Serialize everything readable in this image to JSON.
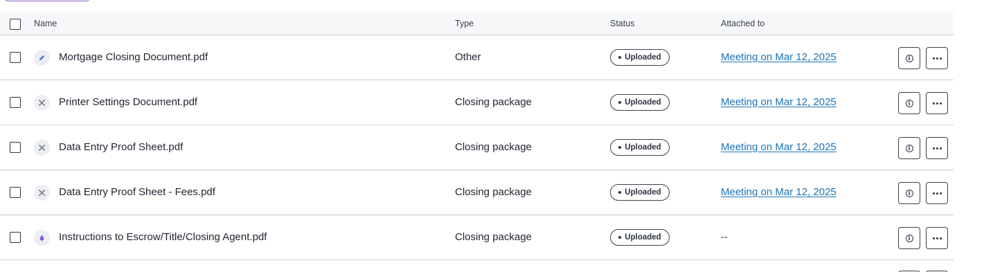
{
  "columns": {
    "name": "Name",
    "type": "Type",
    "status": "Status",
    "attached": "Attached to"
  },
  "rows": [
    {
      "name": "Mortgage Closing Document.pdf",
      "icon": "pencil-icon",
      "type": "Other",
      "status": "Uploaded",
      "attached": "Meeting on Mar 12, 2025",
      "attached_is_link": true
    },
    {
      "name": "Printer Settings Document.pdf",
      "icon": "tools-icon",
      "type": "Closing package",
      "status": "Uploaded",
      "attached": "Meeting on Mar 12, 2025",
      "attached_is_link": true
    },
    {
      "name": "Data Entry Proof Sheet.pdf",
      "icon": "tools-icon",
      "type": "Closing package",
      "status": "Uploaded",
      "attached": "Meeting on Mar 12, 2025",
      "attached_is_link": true
    },
    {
      "name": "Data Entry Proof Sheet - Fees.pdf",
      "icon": "tools-icon",
      "type": "Closing package",
      "status": "Uploaded",
      "attached": "Meeting on Mar 12, 2025",
      "attached_is_link": true
    },
    {
      "name": "Instructions to Escrow/Title/Closing Agent.pdf",
      "icon": "drop-icon",
      "type": "Closing package",
      "status": "Uploaded",
      "attached": "--",
      "attached_is_link": false
    }
  ],
  "colors": {
    "link": "#1a73b8",
    "pencil_icon": "#2f6fd6",
    "tools_icon": "#6b7280",
    "drop_icon": "#8a4fd8",
    "top_button_border": "#8a5cc7"
  }
}
